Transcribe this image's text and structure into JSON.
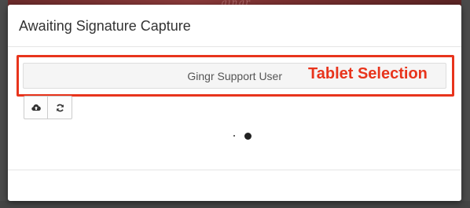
{
  "modal": {
    "title": "Awaiting Signature Capture"
  },
  "tablet": {
    "selected_value": "Gingr Support User",
    "callout_label": "Tablet Selection",
    "highlight_color": "#e8341c"
  },
  "toolbar": {
    "buttons": [
      {
        "icon": "cloud-upload-icon"
      },
      {
        "icon": "refresh-icon"
      }
    ]
  },
  "colors": {
    "backdrop": "#3a3a3a",
    "modal_bg": "#ffffff",
    "select_bg": "#f5f5f5"
  }
}
